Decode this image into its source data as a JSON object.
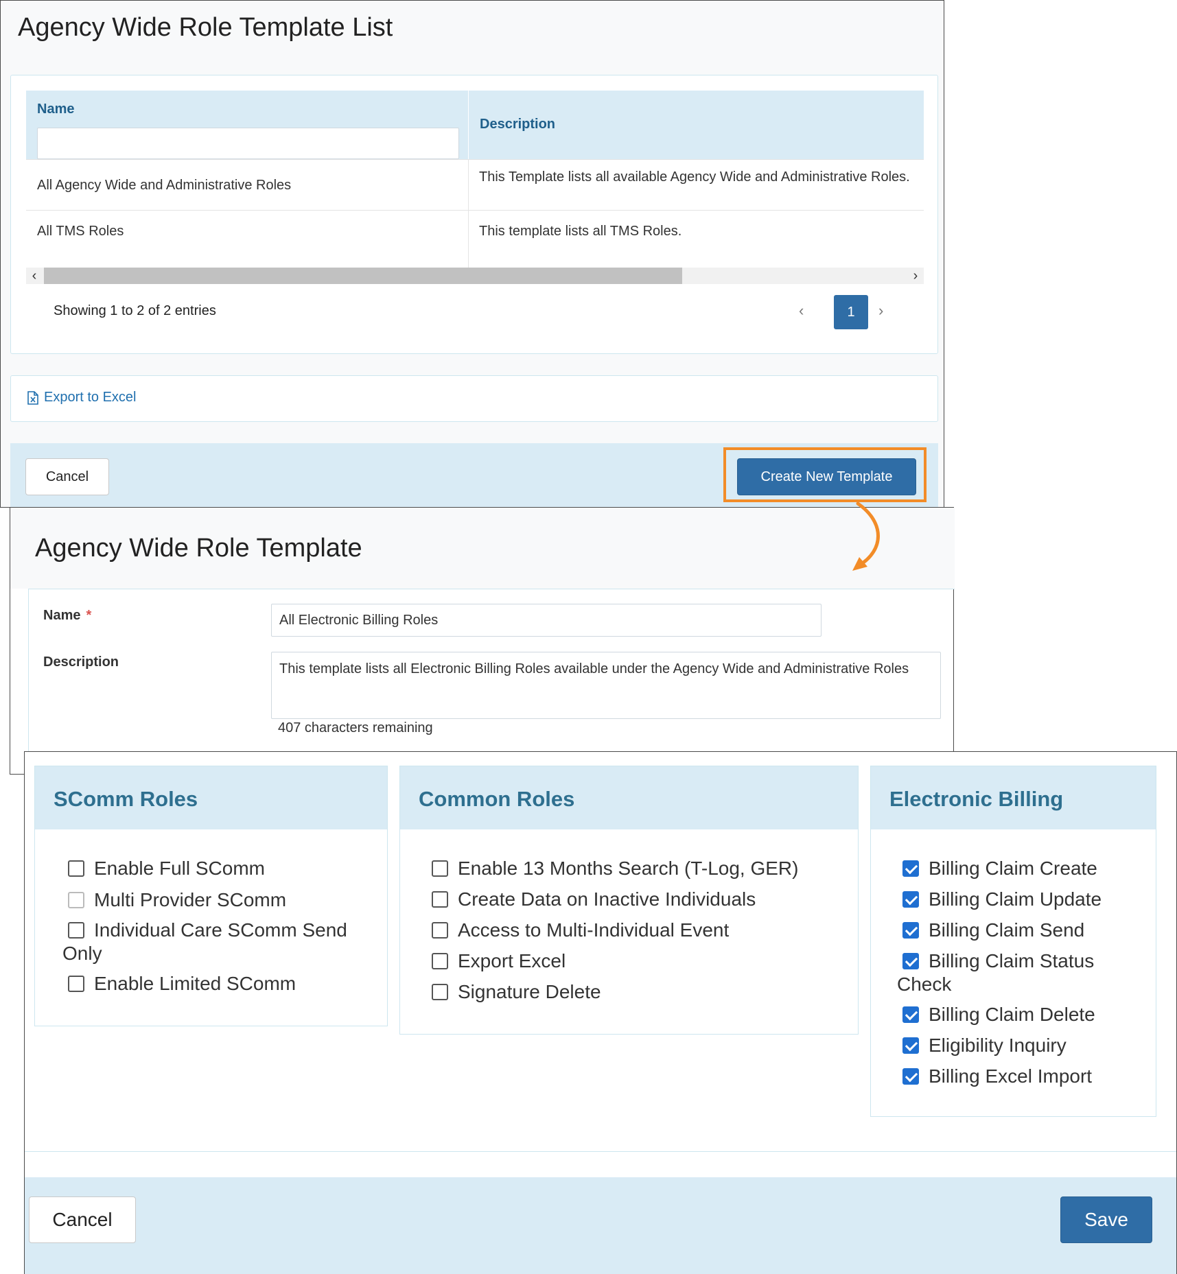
{
  "list_panel": {
    "title": "Agency Wide Role Template List",
    "columns": {
      "name": "Name",
      "description": "Description"
    },
    "name_filter_value": "",
    "rows": [
      {
        "name": "All Agency Wide and Administrative Roles",
        "description": "This Template lists all available Agency Wide and Administrative Roles."
      },
      {
        "name": "All TMS Roles",
        "description": "This template lists all TMS Roles."
      }
    ],
    "showing": "Showing 1 to 2 of 2 entries",
    "current_page": "1",
    "export_label": "Export to Excel",
    "cancel_label": "Cancel",
    "create_label": "Create New Template",
    "highlight_color": "#f28c28"
  },
  "template_panel": {
    "title": "Agency Wide Role Template",
    "name_label": "Name",
    "required_mark": "*",
    "name_value": "All Electronic Billing Roles",
    "description_label": "Description",
    "description_value": "This template lists all Electronic Billing Roles available under the Agency Wide and Administrative Roles",
    "remaining": "407 characters remaining"
  },
  "roles_panel": {
    "groups": [
      {
        "title": "SComm Roles",
        "items": [
          {
            "label": "Enable Full SComm",
            "checked": false,
            "disabled": false
          },
          {
            "label": "Multi Provider SComm",
            "checked": false,
            "disabled": true
          },
          {
            "label": "Individual Care SComm Send Only",
            "checked": false,
            "disabled": false
          },
          {
            "label": "Enable Limited SComm",
            "checked": false,
            "disabled": false
          }
        ]
      },
      {
        "title": "Common Roles",
        "items": [
          {
            "label": "Enable 13 Months Search (T-Log, GER)",
            "checked": false,
            "disabled": false
          },
          {
            "label": "Create Data on Inactive Individuals",
            "checked": false,
            "disabled": false
          },
          {
            "label": "Access to Multi-Individual Event",
            "checked": false,
            "disabled": false
          },
          {
            "label": "Export Excel",
            "checked": false,
            "disabled": false
          },
          {
            "label": "Signature Delete",
            "checked": false,
            "disabled": false
          }
        ]
      },
      {
        "title": "Electronic Billing",
        "items": [
          {
            "label": "Billing Claim Create",
            "checked": true,
            "disabled": false
          },
          {
            "label": "Billing Claim Update",
            "checked": true,
            "disabled": false
          },
          {
            "label": "Billing Claim Send",
            "checked": true,
            "disabled": false
          },
          {
            "label": "Billing Claim Status Check",
            "checked": true,
            "disabled": false
          },
          {
            "label": "Billing Claim Delete",
            "checked": true,
            "disabled": false
          },
          {
            "label": "Eligibility Inquiry",
            "checked": true,
            "disabled": false
          },
          {
            "label": "Billing Excel Import",
            "checked": true,
            "disabled": false
          }
        ]
      }
    ],
    "cancel_label": "Cancel",
    "save_label": "Save"
  }
}
